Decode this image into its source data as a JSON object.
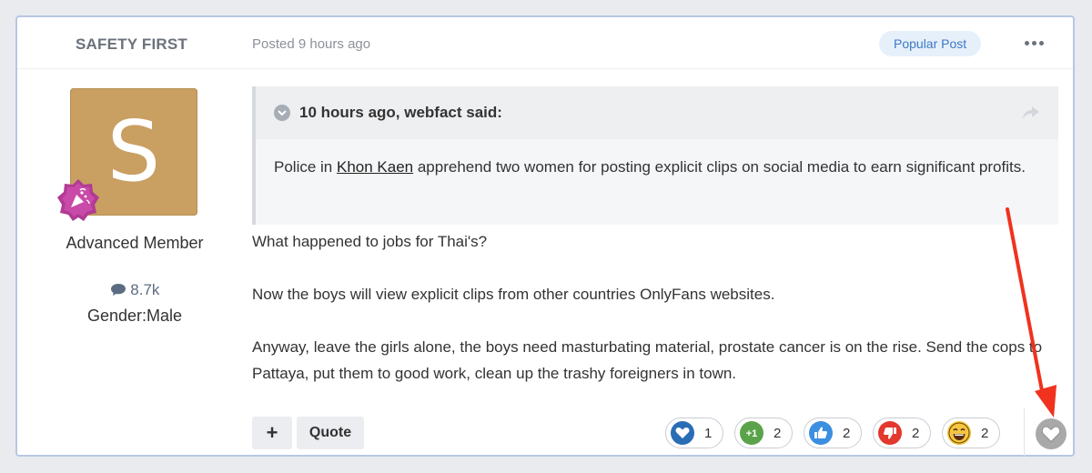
{
  "post": {
    "author_name": "SAFETY FIRST",
    "posted": "Posted 9 hours ago",
    "popular_badge": "Popular Post",
    "more_icon": "ellipsis-icon"
  },
  "author": {
    "avatar_letter": "S",
    "avatar_color": "#c99f62",
    "member_title": "Advanced Member",
    "post_count": "8.7k",
    "gender": "Gender:Male"
  },
  "quote": {
    "header": "10 hours ago, webfact said:",
    "body_before": "Police in ",
    "body_link": "Khon Kaen",
    "body_after": " apprehend two women for posting explicit clips on social media to earn significant profits."
  },
  "content": {
    "paragraphs": [
      "What happened to jobs for Thai's?",
      "Now the boys will view explicit clips from other countries OnlyFans websites.",
      "Anyway, leave the girls alone, the boys need masturbating material, prostate cancer is on the rise. Send the cops to Pattaya, put them to good work, clean up the trashy foreigners in town."
    ]
  },
  "actions": {
    "plus_label": "+",
    "quote_label": "Quote"
  },
  "reactions": [
    {
      "name": "heart",
      "count": "1",
      "color": "#2a6db5"
    },
    {
      "name": "plus-one",
      "count": "2",
      "color": "#5aa34a"
    },
    {
      "name": "thumbs-up",
      "count": "2",
      "color": "#3b8ee0"
    },
    {
      "name": "thumbs-down",
      "count": "2",
      "color": "#e2382e"
    },
    {
      "name": "laugh",
      "count": "2",
      "color": "#f2c12e"
    }
  ],
  "colors": {
    "accent": "#3c79c4",
    "annotation_arrow": "#f0321e"
  }
}
